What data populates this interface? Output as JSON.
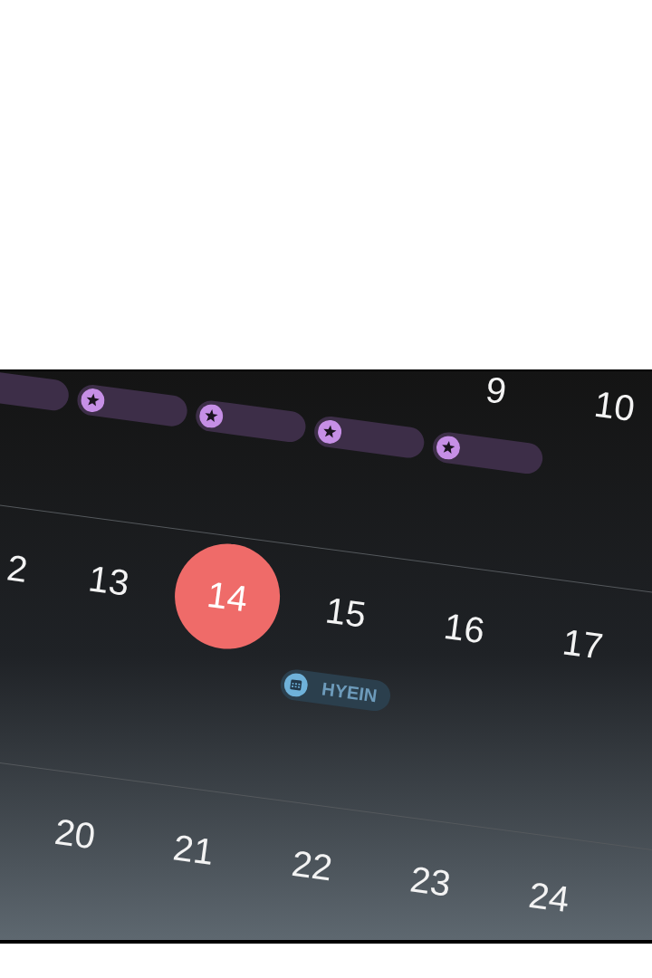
{
  "calendar": {
    "weeks": [
      {
        "days": [
          {
            "events": [
              {
                "kind": "bar"
              }
            ]
          },
          {
            "events": [
              {
                "kind": "bar",
                "star": true
              }
            ]
          },
          {
            "events": [
              {
                "kind": "bar",
                "star": true
              }
            ]
          },
          {
            "events": [
              {
                "kind": "bar",
                "star": true
              }
            ]
          },
          {
            "date": "9",
            "selected": false,
            "events": [
              {
                "kind": "bar",
                "star": true
              }
            ]
          },
          {
            "date": "10",
            "selected": false
          }
        ]
      },
      {
        "days": [
          {
            "date": "2",
            "selected": false
          },
          {
            "date": "13",
            "selected": false
          },
          {
            "date": "14",
            "selected": true
          },
          {
            "date": "15",
            "selected": false,
            "events": [
              {
                "kind": "chip",
                "label": "HYEIN"
              }
            ]
          },
          {
            "date": "16",
            "selected": false
          },
          {
            "date": "17",
            "selected": false
          }
        ]
      },
      {
        "days": [
          {
            "date": "20",
            "selected": false
          },
          {
            "date": "21",
            "selected": false
          },
          {
            "date": "22",
            "selected": false
          },
          {
            "date": "23",
            "selected": false
          },
          {
            "date": "24",
            "selected": false
          }
        ]
      }
    ]
  }
}
